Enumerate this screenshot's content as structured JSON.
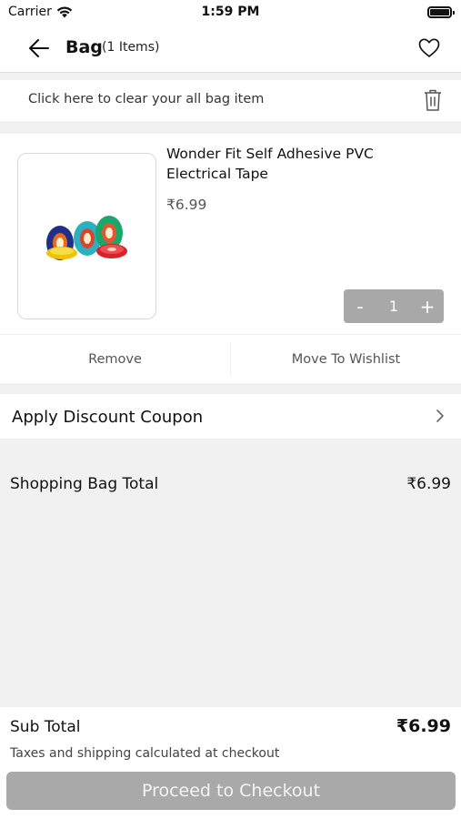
{
  "status_bar": {
    "carrier": "Carrier",
    "time": "1:59 PM"
  },
  "header": {
    "title": "Bag",
    "item_count": "(1 Items)"
  },
  "clear_bag": {
    "label": "Click here to clear your all bag item"
  },
  "cart_item": {
    "name": "Wonder Fit Self Adhesive PVC Electrical Tape",
    "price": "₹6.99",
    "quantity": "1",
    "minus_label": "-",
    "plus_label": "+",
    "remove_label": "Remove",
    "wishlist_label": "Move To Wishlist"
  },
  "coupon": {
    "label": "Apply Discount Coupon"
  },
  "bag_total": {
    "label": "Shopping Bag Total",
    "value": "₹6.99"
  },
  "footer": {
    "subtotal_label": "Sub Total",
    "subtotal_value": "₹6.99",
    "tax_note": "Taxes and shipping calculated at checkout",
    "checkout_label": "Proceed to Checkout"
  },
  "icons": {
    "wifi": "wifi-icon",
    "battery": "battery-icon",
    "back": "arrow-left-icon",
    "wishlist": "heart-icon",
    "trash": "trash-icon",
    "chevron": "chevron-right-icon"
  },
  "colors": {
    "button_disabled": "#a9a9a9",
    "stepper_bg": "#a8a8a8",
    "page_bg": "#f1f1f1"
  }
}
